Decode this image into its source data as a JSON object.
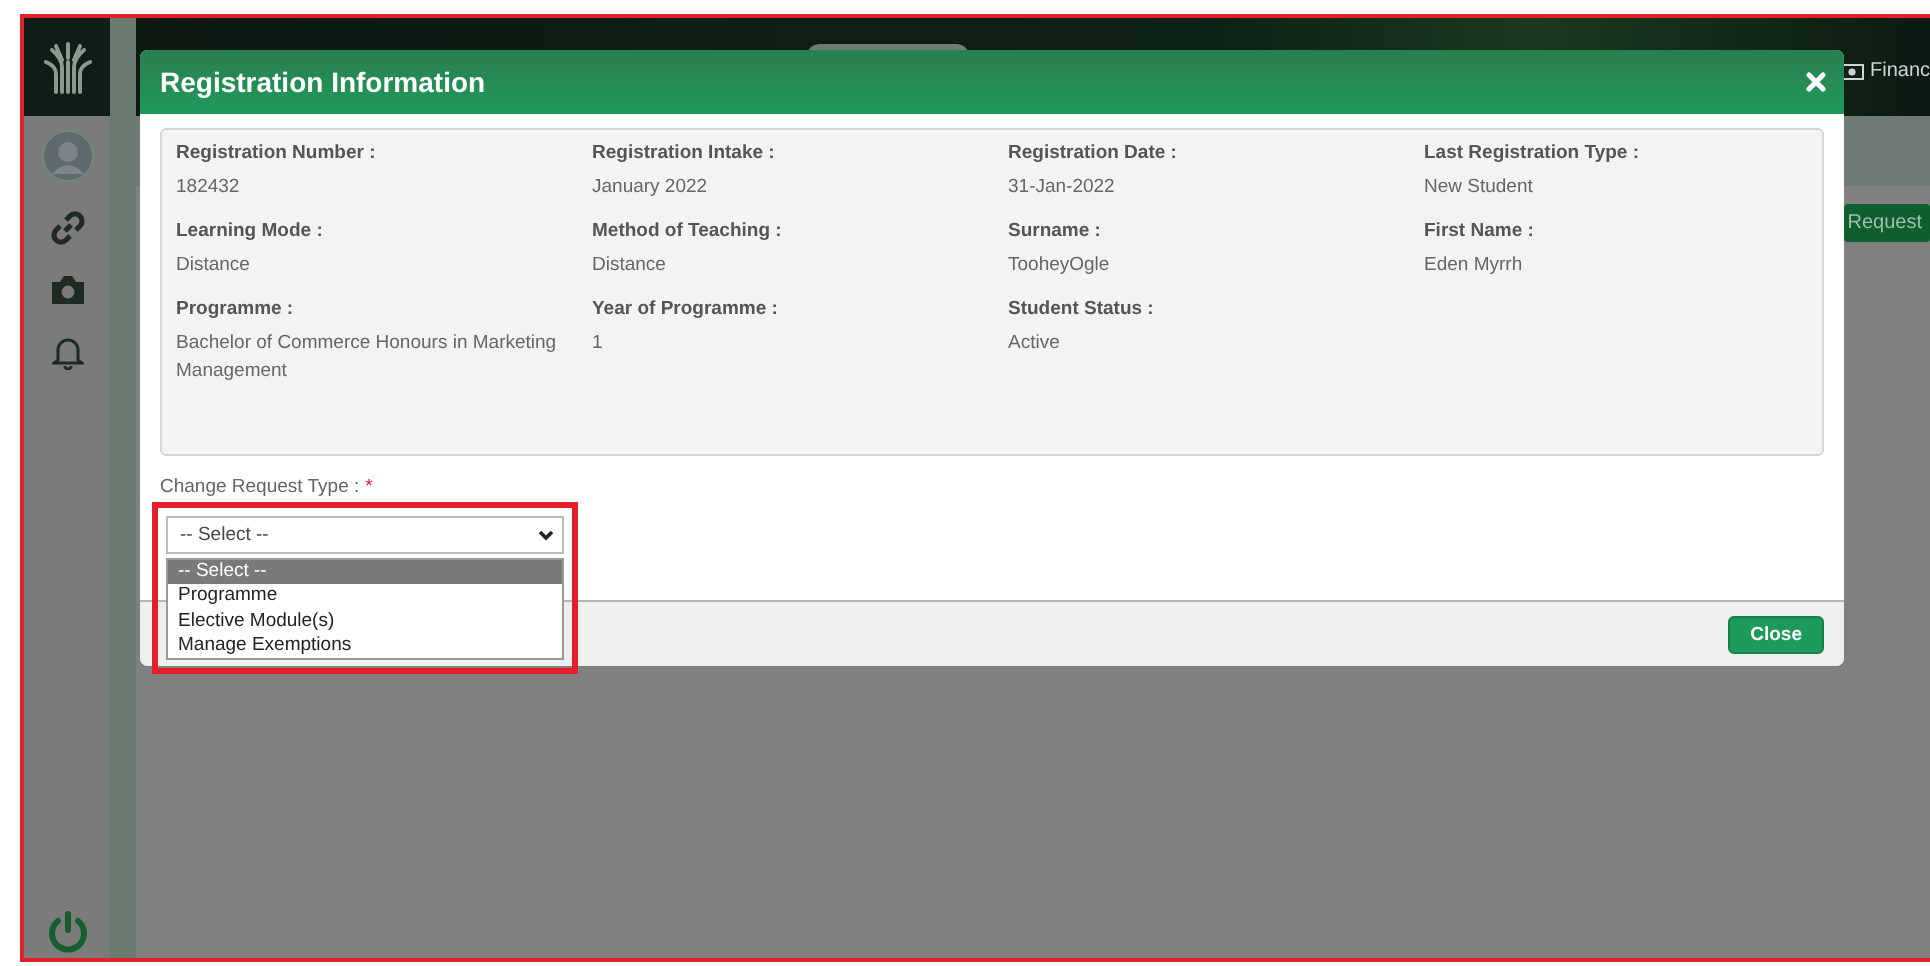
{
  "top_bar": {
    "link": "Financ"
  },
  "page": {
    "request_button": "Request"
  },
  "dialog": {
    "title": "Registration Information",
    "fields": [
      {
        "label": "Registration Number :",
        "value": "182432"
      },
      {
        "label": "Registration Intake :",
        "value": "January 2022"
      },
      {
        "label": "Registration Date :",
        "value": "31-Jan-2022"
      },
      {
        "label": "Last Registration Type :",
        "value": "New Student"
      },
      {
        "label": "Learning Mode :",
        "value": "Distance"
      },
      {
        "label": "Method of Teaching :",
        "value": "Distance"
      },
      {
        "label": "Surname :",
        "value": "TooheyOgle"
      },
      {
        "label": "First Name :",
        "value": "Eden Myrrh"
      },
      {
        "label": "Programme :",
        "value": "Bachelor of Commerce Honours in Marketing Management"
      },
      {
        "label": "Year of Programme :",
        "value": "1"
      },
      {
        "label": "Student Status :",
        "value": "Active"
      }
    ],
    "change_request": {
      "label": "Change Request Type :",
      "required_mark": "*",
      "value": "-- Select --",
      "expanded": true,
      "highlighted": true,
      "options": [
        {
          "label": "-- Select --",
          "selected": true
        },
        {
          "label": "Programme",
          "selected": false
        },
        {
          "label": "Elective Module(s)",
          "selected": false
        },
        {
          "label": "Manage Exemptions",
          "selected": false
        }
      ]
    },
    "close_button": "Close"
  }
}
